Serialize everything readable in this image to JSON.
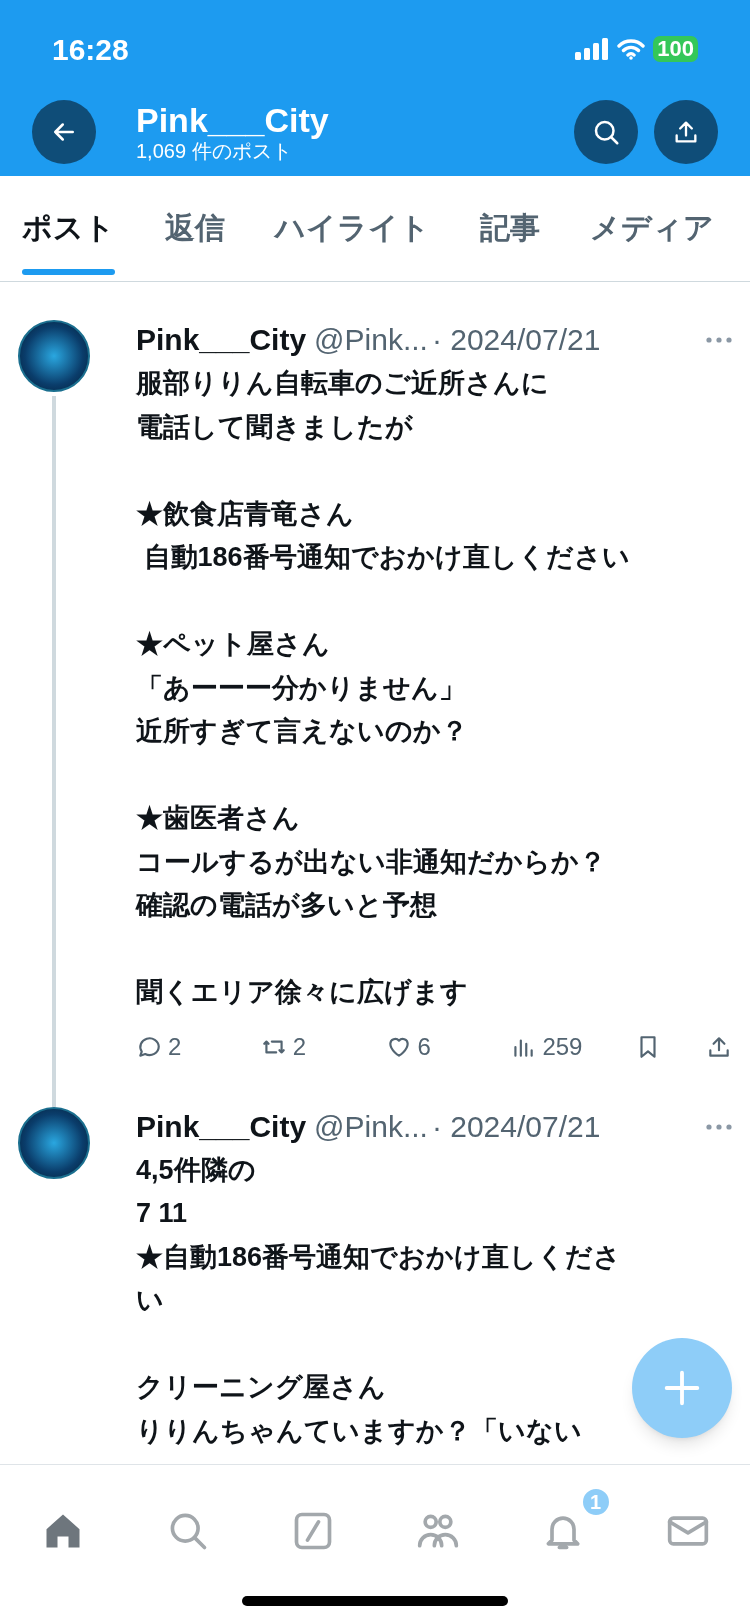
{
  "status_bar": {
    "time": "16:28",
    "battery": "100"
  },
  "header": {
    "title": "Pink___City",
    "subtitle": "1,069 件のポスト"
  },
  "tabs": [
    {
      "label": "ポスト",
      "selected": true
    },
    {
      "label": "返信",
      "selected": false
    },
    {
      "label": "ハイライト",
      "selected": false
    },
    {
      "label": "記事",
      "selected": false
    },
    {
      "label": "メディア",
      "selected": false
    }
  ],
  "posts": [
    {
      "name": "Pink___City",
      "handle": "@Pink...",
      "date": "· 2024/07/21",
      "thread": true,
      "paragraphs": [
        [
          "服部りりん自転車のご近所さんに",
          "電話して聞きましたが"
        ],
        [
          "★飲食店青竜さん",
          " 自動186番号通知でおかけ直しください"
        ],
        [
          "★ペット屋さん",
          "「あーーー分かりません」",
          "近所すぎて言えないのか？"
        ],
        [
          "★歯医者さん",
          "コールするが出ない非通知だからか？",
          "確認の電話が多いと予想"
        ],
        [
          "聞くエリア徐々に広げます"
        ]
      ],
      "actions": {
        "replies": "2",
        "reposts": "2",
        "likes": "6",
        "views": "259"
      }
    },
    {
      "name": "Pink___City",
      "handle": "@Pink...",
      "date": "· 2024/07/21",
      "thread": false,
      "paragraphs": [
        [
          "4,5件隣の",
          "7 11",
          "★自動186番号通知でおかけ直しくださ",
          "い"
        ],
        [
          "クリーニング屋さん",
          "りりんちゃんていますか？「いない"
        ]
      ]
    }
  ],
  "nav": [
    {
      "kind": "home",
      "selected": true
    },
    {
      "kind": "search",
      "selected": false
    },
    {
      "kind": "grok",
      "selected": false
    },
    {
      "kind": "people",
      "selected": false
    },
    {
      "kind": "bell",
      "selected": false,
      "badge": "1"
    },
    {
      "kind": "mail",
      "selected": false
    }
  ]
}
